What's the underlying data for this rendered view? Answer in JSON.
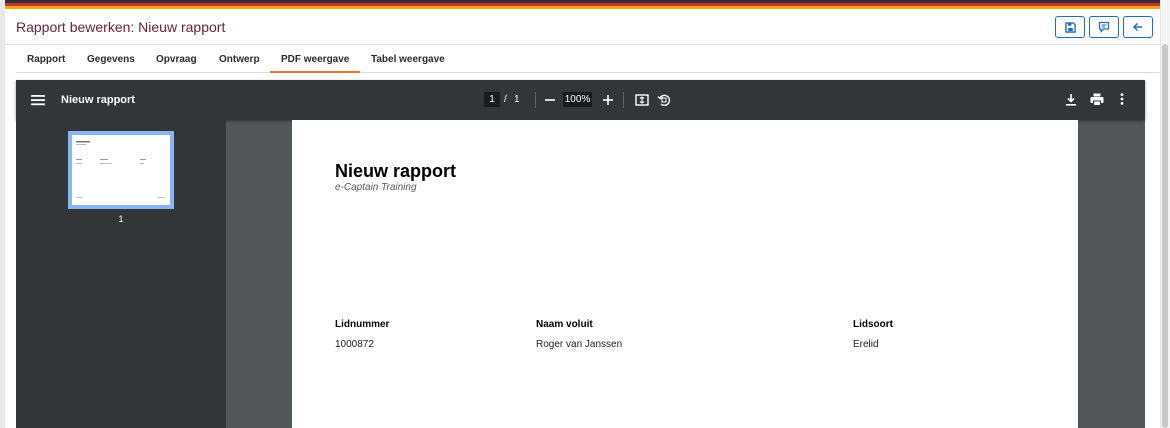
{
  "header": {
    "title": "Rapport bewerken: Nieuw rapport",
    "stripe_colors": [
      "#3a2a3a",
      "#c0392b",
      "#f0a818"
    ],
    "buttons": [
      {
        "name": "save",
        "icon": "save-icon"
      },
      {
        "name": "comment",
        "icon": "comment-icon"
      },
      {
        "name": "back",
        "icon": "arrow-left-icon"
      }
    ]
  },
  "tabs": [
    {
      "label": "Rapport"
    },
    {
      "label": "Gegevens"
    },
    {
      "label": "Opvraag"
    },
    {
      "label": "Ontwerp"
    },
    {
      "label": "PDF weergave",
      "active": true
    },
    {
      "label": "Tabel weergave"
    }
  ],
  "viewer": {
    "doc_title": "Nieuw rapport",
    "page_current": "1",
    "page_sep": "/",
    "page_total": "1",
    "zoom": "100%",
    "thumbnail_label": "1",
    "colors": {
      "toolbar": "#323639",
      "background": "#525659",
      "thumb_border": "#8ab4f8"
    }
  },
  "document": {
    "title": "Nieuw rapport",
    "subtitle": "e-Captain Training",
    "columns": [
      "Lidnummer",
      "Naam voluit",
      "Lidsoort"
    ],
    "rows": [
      [
        "1000872",
        "Roger van Janssen",
        "Erelid"
      ]
    ]
  },
  "colors": {
    "title": "#6b1f3a",
    "accent": "#1f6fb8",
    "tab_underline": "#e8772e"
  }
}
